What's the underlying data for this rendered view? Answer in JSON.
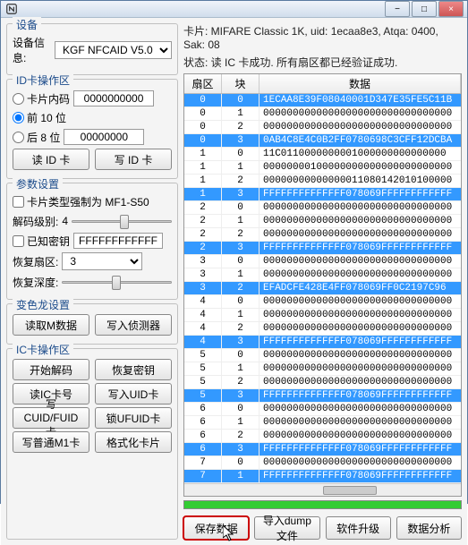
{
  "titlebar": {
    "icon": "nfc"
  },
  "device": {
    "title": "设备",
    "info_label": "设备信息:",
    "info_value": "KGF NFCAID V5.0"
  },
  "id_ops": {
    "title": "ID卡操作区",
    "card_num_label": "卡片内码",
    "card_num_value": "0000000000",
    "front10_label": "前 10 位",
    "back8_label": "后  8 位",
    "back8_value": "00000000",
    "read_btn": "读 ID 卡",
    "write_btn": "写 ID 卡"
  },
  "params": {
    "title": "参数设置",
    "force_type_label": "卡片类型强制为 MF1-S50",
    "decode_level_label": "解码级别:",
    "decode_level_value": "4",
    "known_key_label": "已知密钥",
    "known_key_value": "FFFFFFFFFFFF",
    "recover_sector_label": "恢复扇区:",
    "recover_sector_value": "3",
    "recover_depth_label": "恢复深度:"
  },
  "chameleon": {
    "title": "变色龙设置",
    "read_btn": "读取M数据",
    "write_btn": "写入侦测器"
  },
  "ic_ops": {
    "title": "IC卡操作区",
    "start_decode": "开始解码",
    "recover_key": "恢复密钥",
    "read_ic": "读IC卡号",
    "write_uid": "写入UID卡",
    "write_cuid": "写CUID/FUID卡",
    "lock_ufuid": "锁UFUID卡",
    "write_m1": "写普通M1卡",
    "format_card": "格式化卡片"
  },
  "status": {
    "card_info": "卡片: MIFARE Classic 1K, uid: 1ecaa8e3, Atqa: 0400, Sak: 08",
    "state": "状态: 读 IC 卡成功. 所有扇区都已经验证成功."
  },
  "table": {
    "h1": "扇区",
    "h2": "块",
    "h3": "数据",
    "rows": [
      {
        "s": "0",
        "b": "0",
        "d": "1ECAA8E39F08040001D347E35FE5C11B",
        "hl": true
      },
      {
        "s": "0",
        "b": "1",
        "d": "00000000000000000000000000000000",
        "hl": false
      },
      {
        "s": "0",
        "b": "2",
        "d": "00000000000000000000000000000000",
        "hl": false
      },
      {
        "s": "0",
        "b": "3",
        "d": "0AB4C8E4C0B2FF0780698C3CFF12DCBA",
        "hl": true
      },
      {
        "s": "1",
        "b": "0",
        "d": "11C0110000000001000000000000000",
        "hl": false
      },
      {
        "s": "1",
        "b": "1",
        "d": "00000000100000000000000000000000",
        "hl": false
      },
      {
        "s": "1",
        "b": "2",
        "d": "00000000000000011080142010100000",
        "hl": false
      },
      {
        "s": "1",
        "b": "3",
        "d": "FFFFFFFFFFFFFF078069FFFFFFFFFFFF",
        "hl": true
      },
      {
        "s": "2",
        "b": "0",
        "d": "00000000000000000000000000000000",
        "hl": false
      },
      {
        "s": "2",
        "b": "1",
        "d": "00000000000000000000000000000000",
        "hl": false
      },
      {
        "s": "2",
        "b": "2",
        "d": "00000000000000000000000000000000",
        "hl": false
      },
      {
        "s": "2",
        "b": "3",
        "d": "FFFFFFFFFFFFFF078069FFFFFFFFFFFF",
        "hl": true
      },
      {
        "s": "3",
        "b": "0",
        "d": "00000000000000000000000000000000",
        "hl": false
      },
      {
        "s": "3",
        "b": "1",
        "d": "00000000000000000000000000000000",
        "hl": false
      },
      {
        "s": "3",
        "b": "2",
        "d": "EFADCFE428E4FF078069FF0C2197C96",
        "hl": true
      },
      {
        "s": "4",
        "b": "0",
        "d": "00000000000000000000000000000000",
        "hl": false
      },
      {
        "s": "4",
        "b": "1",
        "d": "00000000000000000000000000000000",
        "hl": false
      },
      {
        "s": "4",
        "b": "2",
        "d": "00000000000000000000000000000000",
        "hl": false
      },
      {
        "s": "4",
        "b": "3",
        "d": "FFFFFFFFFFFFFF078069FFFFFFFFFFFF",
        "hl": true
      },
      {
        "s": "5",
        "b": "0",
        "d": "00000000000000000000000000000000",
        "hl": false
      },
      {
        "s": "5",
        "b": "1",
        "d": "00000000000000000000000000000000",
        "hl": false
      },
      {
        "s": "5",
        "b": "2",
        "d": "00000000000000000000000000000000",
        "hl": false
      },
      {
        "s": "5",
        "b": "3",
        "d": "FFFFFFFFFFFFFF078069FFFFFFFFFFFF",
        "hl": true
      },
      {
        "s": "6",
        "b": "0",
        "d": "00000000000000000000000000000000",
        "hl": false
      },
      {
        "s": "6",
        "b": "1",
        "d": "00000000000000000000000000000000",
        "hl": false
      },
      {
        "s": "6",
        "b": "2",
        "d": "00000000000000000000000000000000",
        "hl": false
      },
      {
        "s": "6",
        "b": "3",
        "d": "FFFFFFFFFFFFFF078069FFFFFFFFFFFF",
        "hl": true
      },
      {
        "s": "7",
        "b": "0",
        "d": "00000000000000000000000000000000",
        "hl": false
      },
      {
        "s": "7",
        "b": "1",
        "d": "FFFFFFFFFFFFFF078069FFFFFFFFFFFF",
        "hl": true
      }
    ]
  },
  "bottom": {
    "save_data": "保存数据",
    "import_dump": "导入dump文件",
    "upgrade": "软件升级",
    "analyze": "数据分析"
  }
}
